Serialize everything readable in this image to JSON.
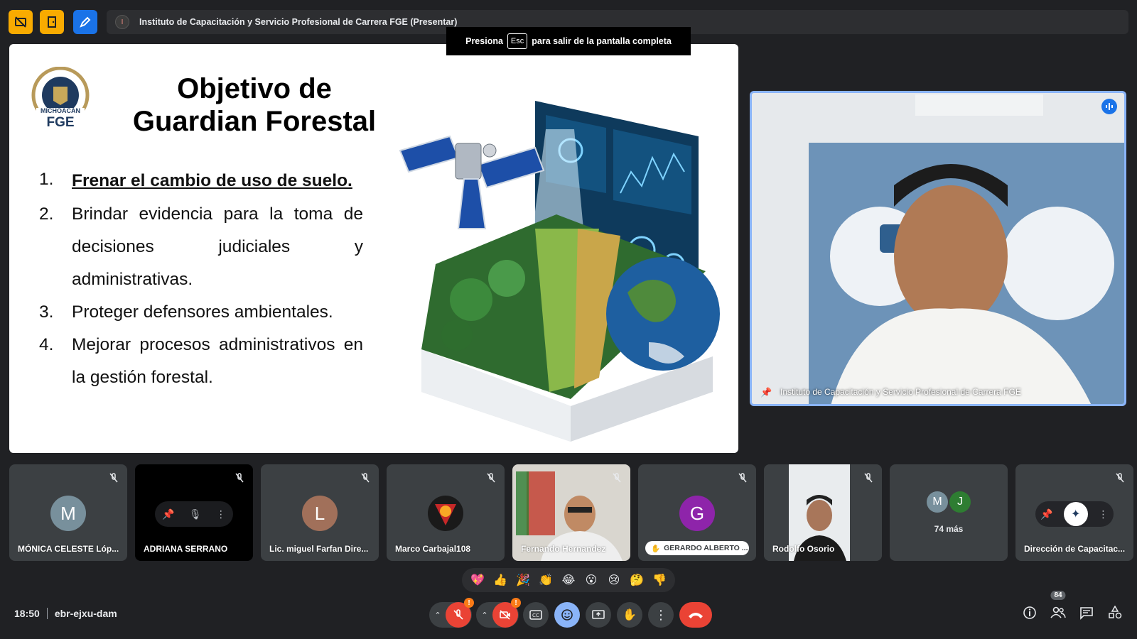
{
  "topbar": {
    "presentation_title": "Instituto de Capacitación y Servicio Profesional de Carrera FGE (Presentar)",
    "presenter_initial": "I"
  },
  "fullscreen_hint": {
    "before": "Presiona",
    "key": "Esc",
    "after": "para salir de la pantalla completa"
  },
  "slide": {
    "logo_text": "MICHOACÁN FGE",
    "title_line1": "Objetivo de",
    "title_line2": "Guardian Forestal",
    "objectives": [
      {
        "num": "1.",
        "text": "Frenar el cambio de uso de suelo."
      },
      {
        "num": "2.",
        "text": "Brindar evidencia para la toma de decisiones judiciales y administrativas."
      },
      {
        "num": "3.",
        "text": "Proteger defensores ambientales."
      },
      {
        "num": "4.",
        "text": "Mejorar procesos administrativos en la gestión forestal."
      }
    ]
  },
  "speaker": {
    "name": "Instituto de Capacitación y Servicio Profesional de Carrera FGE"
  },
  "participants": [
    {
      "name": "MÓNICA CELESTE Lóp...",
      "initial": "M",
      "color": "#78909c"
    },
    {
      "name": "ADRIANA SERRANO"
    },
    {
      "name": "Lic. miguel Farfan Dire...",
      "initial": "L",
      "color": "#a1705a"
    },
    {
      "name": "Marco Carbajal108"
    },
    {
      "name": "Fernando Hernandez"
    },
    {
      "name": "GERARDO ALBERTO ...",
      "initial": "G",
      "color": "#8e24aa"
    },
    {
      "name": "Rodolfo Osorio"
    },
    {
      "more_label": "74 más",
      "a1": "M",
      "a2": "J"
    },
    {
      "name": "Dirección de Capacitac..."
    }
  ],
  "reactions": [
    "💖",
    "👍",
    "🎉",
    "👏",
    "😂",
    "😮",
    "😢",
    "🤔",
    "👎"
  ],
  "bottom": {
    "time": "18:50",
    "meeting_code": "ebr-ejxu-dam",
    "people_count": "84"
  },
  "colors": {
    "background": "#202124",
    "tile": "#3c4043",
    "accent": "#8ab4f8",
    "end_call": "#ea4335",
    "warning": "#fa7b17"
  }
}
